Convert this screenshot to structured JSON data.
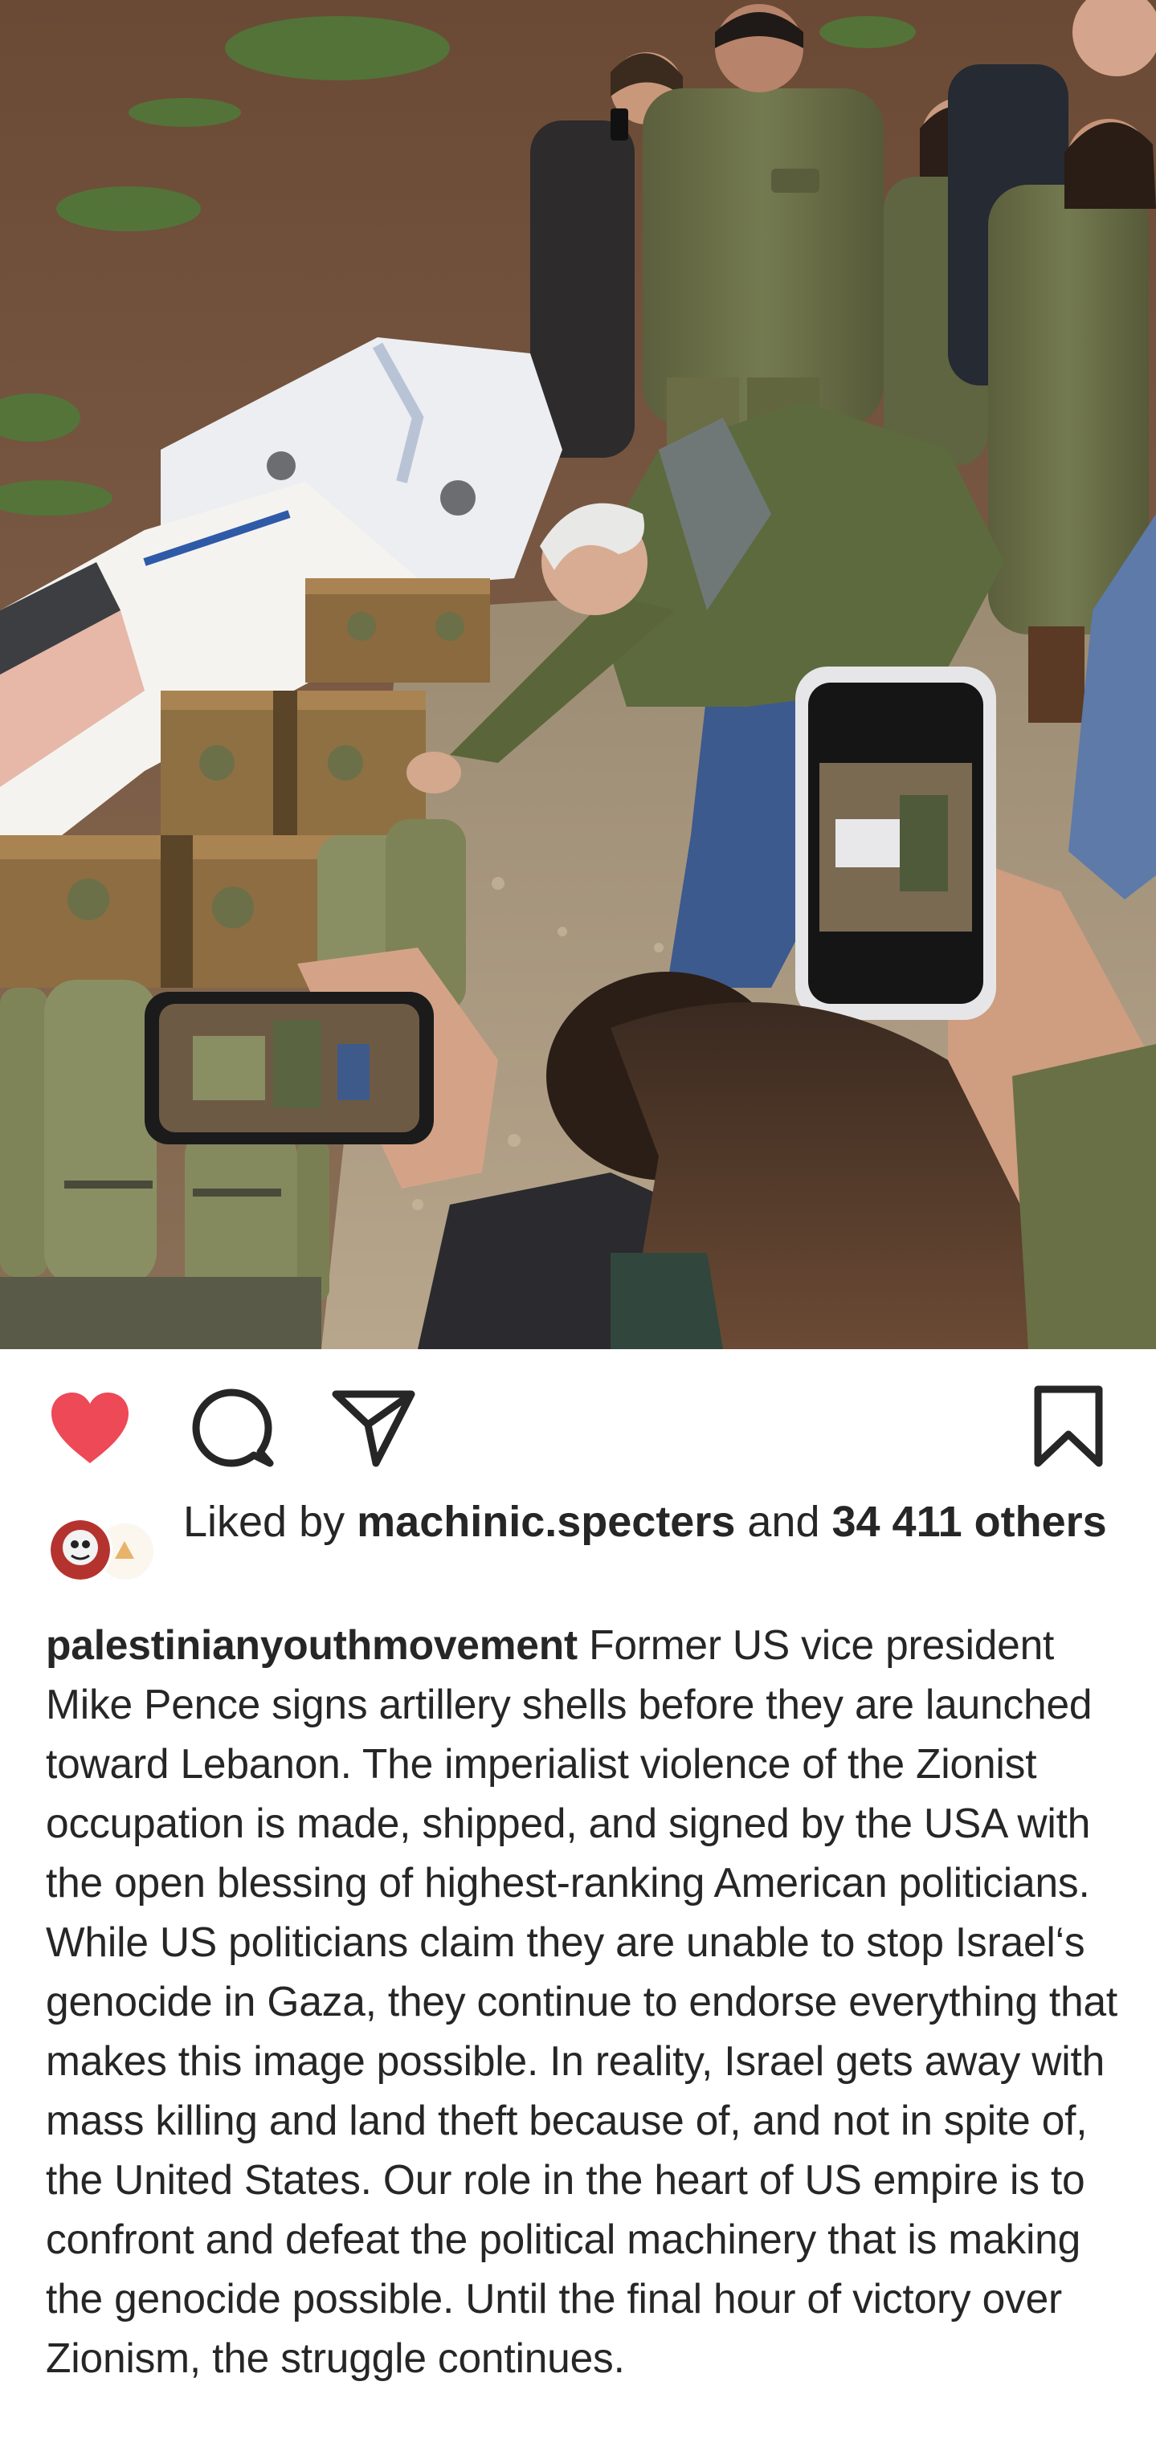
{
  "post": {
    "image_alt": "",
    "actions": {
      "like_icon": "heart-filled-icon",
      "comment_icon": "comment-bubble-icon",
      "share_icon": "paper-plane-icon",
      "save_icon": "bookmark-icon",
      "liked": true
    },
    "likes": {
      "prefix": "Liked by ",
      "user": "machinic.specters",
      "middle": " and ",
      "count": "34 411",
      "suffix": " others"
    },
    "caption": {
      "username": "palestinianyouthmovement",
      "text": "Former US vice president Mike Pence signs artillery shells before they are launched toward Lebanon. The imperialist violence of the Zionist occupation is made, shipped, and signed by the USA with the open blessing of highest-ranking American politicians. While US politicians claim they are unable to stop Israel‘s genocide in Gaza, they continue to endorse everything that makes this image possible. In reality, Israel gets away with mass killing and land theft because of, and not in spite of, the United States. Our role in the heart of US empire is to confront and defeat the political machinery that is making the genocide possible. Until the final hour of victory over Zionism, the struggle continues."
    }
  },
  "colors": {
    "like_red": "#ed4956",
    "icon_dark": "#262626",
    "text": "#262626",
    "background": "#ffffff"
  }
}
